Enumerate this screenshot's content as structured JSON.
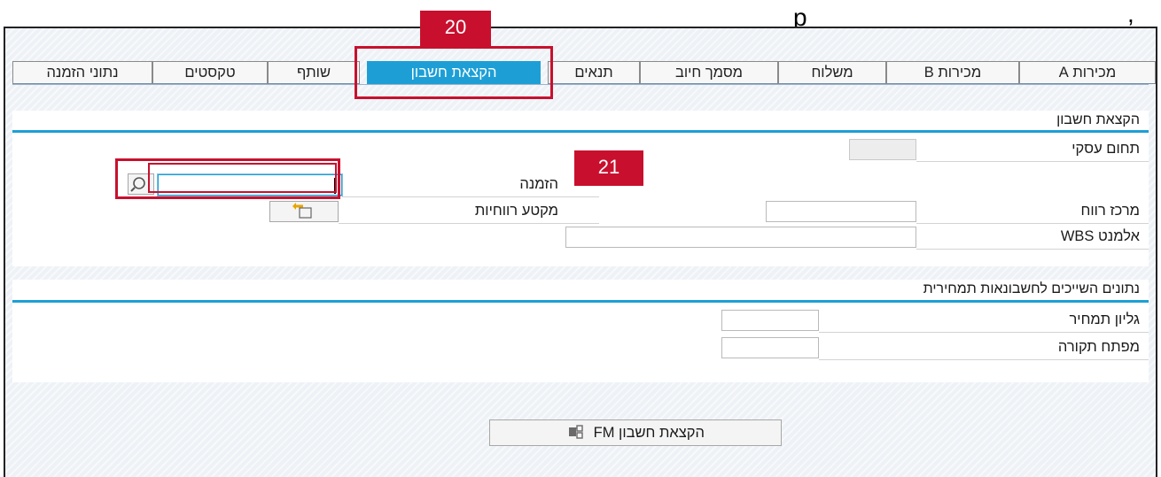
{
  "header": {
    "fragment_left": "p",
    "fragment_right": ","
  },
  "tabs": [
    {
      "label": "מכירות A",
      "active": false
    },
    {
      "label": "מכירות B",
      "active": false
    },
    {
      "label": "משלוח",
      "active": false
    },
    {
      "label": "מסמך חיוב",
      "active": false
    },
    {
      "label": "תנאים",
      "active": false
    },
    {
      "label": "הקצאת חשבון",
      "active": true
    },
    {
      "label": "שותף",
      "active": false
    },
    {
      "label": "טקסטים",
      "active": false
    },
    {
      "label": "נתוני הזמנה",
      "active": false
    }
  ],
  "account_assignment": {
    "title": "הקצאת חשבון",
    "business_area_label": "תחום עסקי",
    "business_area_value": "",
    "order_label": "הזמנה",
    "order_value": "",
    "profit_center_label": "מרכז רווח",
    "profit_center_value": "",
    "profitability_segment_label": "מקטע רווחיות",
    "wbs_label": "אלמנט WBS",
    "wbs_value": ""
  },
  "costing": {
    "title": "נתונים השייכים לחשבונאות תמחירית",
    "cost_sheet_label": "גליון תמחיר",
    "cost_sheet_value": "",
    "overhead_key_label": "מפתח תקורה",
    "overhead_key_value": ""
  },
  "fm_button": {
    "label": "הקצאת חשבון FM",
    "icon": "fm-assignment-icon"
  },
  "callouts": [
    {
      "number": "20"
    },
    {
      "number": "21"
    }
  ],
  "colors": {
    "accent": "#1d9fd6",
    "callout": "#c8102e"
  }
}
